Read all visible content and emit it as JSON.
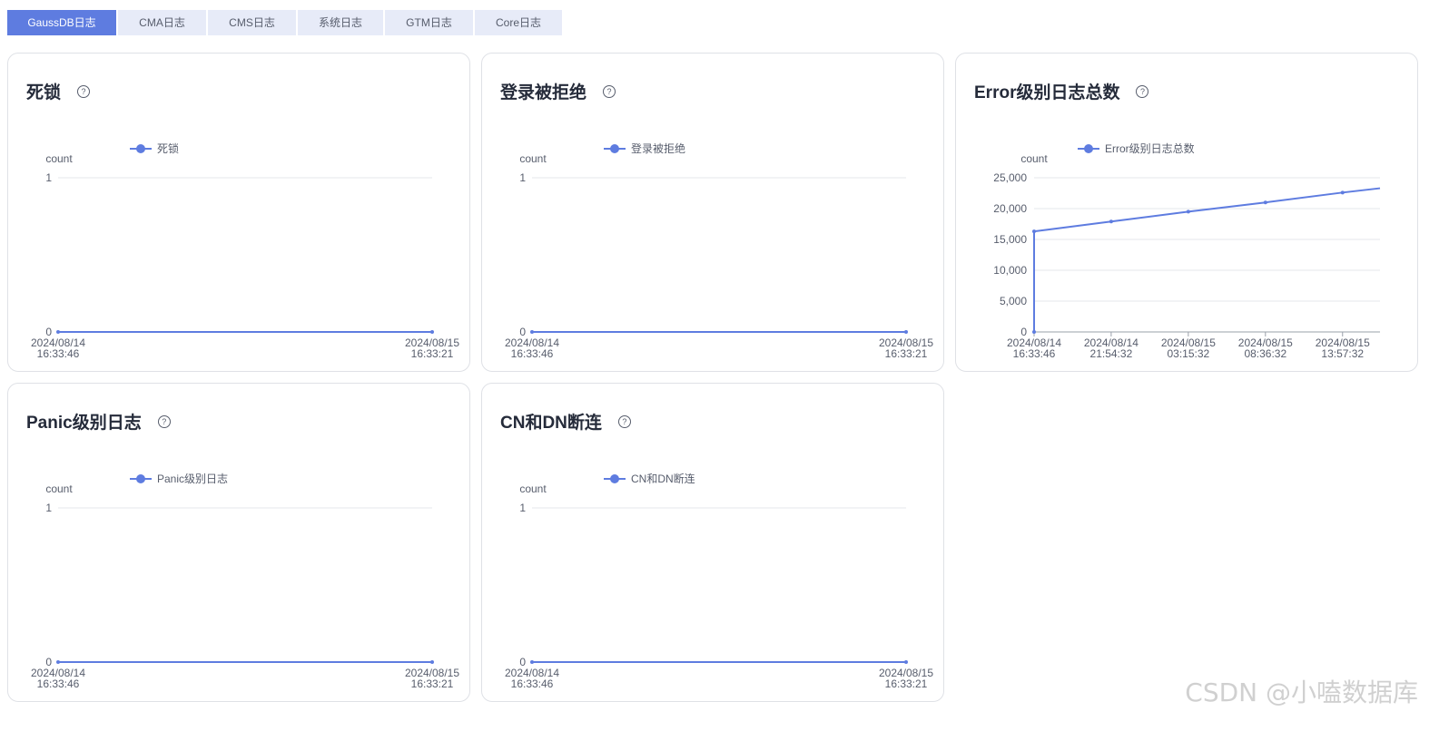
{
  "tabs": [
    {
      "label": "GaussDB日志",
      "active": true
    },
    {
      "label": "CMA日志",
      "active": false
    },
    {
      "label": "CMS日志",
      "active": false
    },
    {
      "label": "系统日志",
      "active": false
    },
    {
      "label": "GTM日志",
      "active": false
    },
    {
      "label": "Core日志",
      "active": false
    }
  ],
  "colors": {
    "accent": "#5e7ce0",
    "grid": "#e5e7eb",
    "axis": "#9aa0aa"
  },
  "help_icon": "question-circle-icon",
  "cards": [
    {
      "title": "死锁",
      "chart_data": {
        "type": "line",
        "title": "死锁",
        "ylabel": "count",
        "series": [
          {
            "name": "死锁",
            "values": [
              0,
              0
            ]
          }
        ],
        "x": [
          "2024/08/14 16:33:46",
          "2024/08/15 16:33:21"
        ],
        "xticks": [
          "2024/08/14|16:33:46",
          "2024/08/15|16:33:21"
        ],
        "yticks": [
          "0",
          "1"
        ],
        "ylim": [
          0,
          1
        ],
        "grid": true,
        "legend": "top"
      }
    },
    {
      "title": "登录被拒绝",
      "chart_data": {
        "type": "line",
        "title": "登录被拒绝",
        "ylabel": "count",
        "series": [
          {
            "name": "登录被拒绝",
            "values": [
              0,
              0
            ]
          }
        ],
        "x": [
          "2024/08/14 16:33:46",
          "2024/08/15 16:33:21"
        ],
        "xticks": [
          "2024/08/14|16:33:46",
          "2024/08/15|16:33:21"
        ],
        "yticks": [
          "0",
          "1"
        ],
        "ylim": [
          0,
          1
        ],
        "grid": true,
        "legend": "top"
      }
    },
    {
      "title": "Error级别日志总数",
      "chart_data": {
        "type": "line",
        "title": "Error级别日志总数",
        "ylabel": "count",
        "series": [
          {
            "name": "Error级别日志总数",
            "values": [
              0,
              16300,
              17900,
              19500,
              21000,
              22600,
              23300
            ]
          }
        ],
        "x": [
          "2024/08/14 16:33:46",
          "2024/08/14 16:33:46",
          "2024/08/14 21:54:32",
          "2024/08/15 03:15:32",
          "2024/08/15 08:36:32",
          "2024/08/15 13:57:32",
          "2024/08/15 16:33:21"
        ],
        "xticks": [
          "2024/08/14|16:33:46",
          "2024/08/14|21:54:32",
          "2024/08/15|03:15:32",
          "2024/08/15|08:36:32",
          "2024/08/15|13:57:32"
        ],
        "yticks": [
          "0",
          "5,000",
          "10,000",
          "15,000",
          "20,000",
          "25,000"
        ],
        "ylim": [
          0,
          25000
        ],
        "grid": true,
        "legend": "top"
      }
    },
    {
      "title": "Panic级别日志",
      "chart_data": {
        "type": "line",
        "title": "Panic级别日志",
        "ylabel": "count",
        "series": [
          {
            "name": "Panic级别日志",
            "values": [
              0,
              0
            ]
          }
        ],
        "x": [
          "2024/08/14 16:33:46",
          "2024/08/15 16:33:21"
        ],
        "xticks": [
          "2024/08/14|16:33:46",
          "2024/08/15|16:33:21"
        ],
        "yticks": [
          "0",
          "1"
        ],
        "ylim": [
          0,
          1
        ],
        "grid": true,
        "legend": "top"
      }
    },
    {
      "title": "CN和DN断连",
      "chart_data": {
        "type": "line",
        "title": "CN和DN断连",
        "ylabel": "count",
        "series": [
          {
            "name": "CN和DN断连",
            "values": [
              0,
              0
            ]
          }
        ],
        "x": [
          "2024/08/14 16:33:46",
          "2024/08/15 16:33:21"
        ],
        "xticks": [
          "2024/08/14|16:33:46",
          "2024/08/15|16:33:21"
        ],
        "yticks": [
          "0",
          "1"
        ],
        "ylim": [
          0,
          1
        ],
        "grid": true,
        "legend": "top"
      }
    }
  ],
  "watermark": "CSDN @小嗑数据库"
}
